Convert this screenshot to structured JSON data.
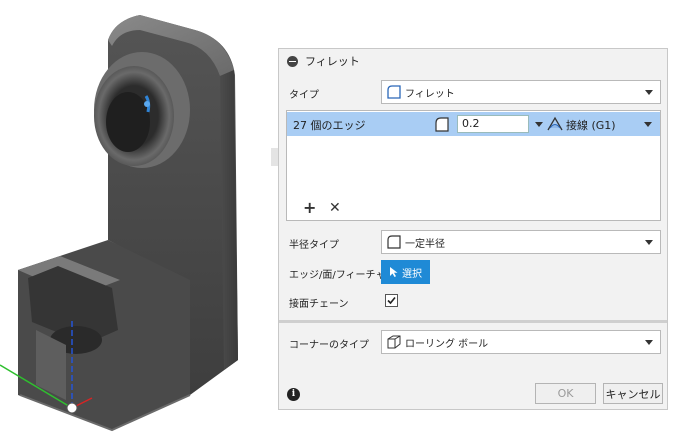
{
  "panel": {
    "title": "フィレット",
    "type_label": "タイプ",
    "type_value": "フィレット",
    "edge_row": {
      "label": "27 個のエッジ",
      "radius_value": "0.2",
      "tangent_label": "接線 (G1)"
    },
    "radius_type_label": "半径タイプ",
    "radius_type_value": "一定半径",
    "edge_select_label": "エッジ/面/フィーチャ",
    "select_button_label": "選択",
    "tangent_chain_label": "接面チェーン",
    "tangent_chain_checked": true,
    "corner_type_label": "コーナーのタイプ",
    "corner_type_value": "ローリング ボール",
    "ok_label": "OK",
    "cancel_label": "キャンセル"
  },
  "icons": {
    "collapse": "minus-circle-icon",
    "fillet_type": "fillet-icon",
    "radius": "fillet-radius-icon",
    "tangent": "tangent-icon",
    "add": "plus-icon",
    "remove": "x-icon",
    "radius_type": "fillet-icon",
    "select": "cursor-arrow-icon",
    "checkbox": "checkmark-icon",
    "corner_type": "rolling-ball-corner-icon",
    "info": "info-icon"
  },
  "colors": {
    "selected_row": "#a9cdf4",
    "select_button": "#1f8ad6",
    "model_body": "#5a5a5a",
    "highlight_edge": "#2f84d6"
  }
}
